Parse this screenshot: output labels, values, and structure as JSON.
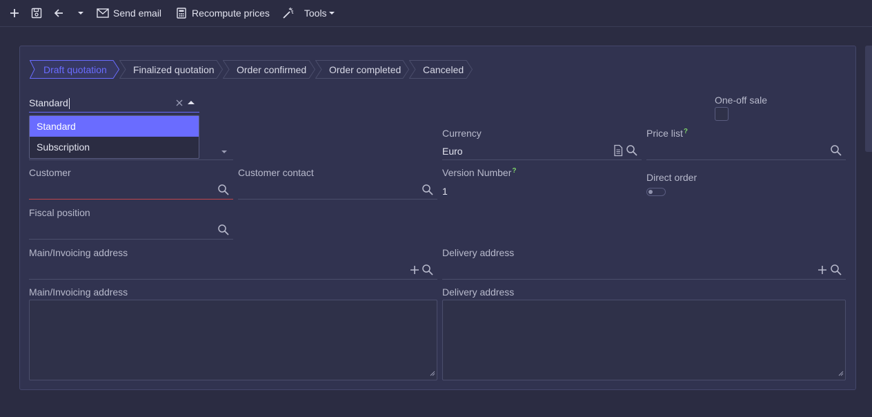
{
  "toolbar": {
    "send_email": "Send email",
    "recompute_prices": "Recompute prices",
    "tools": "Tools"
  },
  "steps": [
    "Draft quotation",
    "Finalized quotation",
    "Order confirmed",
    "Order completed",
    "Canceled"
  ],
  "type_select": {
    "value": "Standard",
    "options": [
      "Standard",
      "Subscription"
    ]
  },
  "one_off_sale": {
    "label": "One-off sale"
  },
  "currency": {
    "label": "Currency",
    "value": "Euro"
  },
  "price_list": {
    "label": "Price list",
    "help": "?"
  },
  "customer": {
    "label": "Customer"
  },
  "customer_contact": {
    "label": "Customer contact"
  },
  "version_number": {
    "label": "Version Number",
    "help": "?",
    "value": "1"
  },
  "direct_order": {
    "label": "Direct order"
  },
  "fiscal_position": {
    "label": "Fiscal position"
  },
  "main_invoicing_address": {
    "label": "Main/Invoicing address"
  },
  "delivery_address": {
    "label": "Delivery address"
  },
  "main_invoicing_address_text": {
    "label": "Main/Invoicing address"
  },
  "delivery_address_text": {
    "label": "Delivery address"
  },
  "colors": {
    "accent": "#6a6cff",
    "error": "#c2474c",
    "help": "#7fd46a"
  }
}
